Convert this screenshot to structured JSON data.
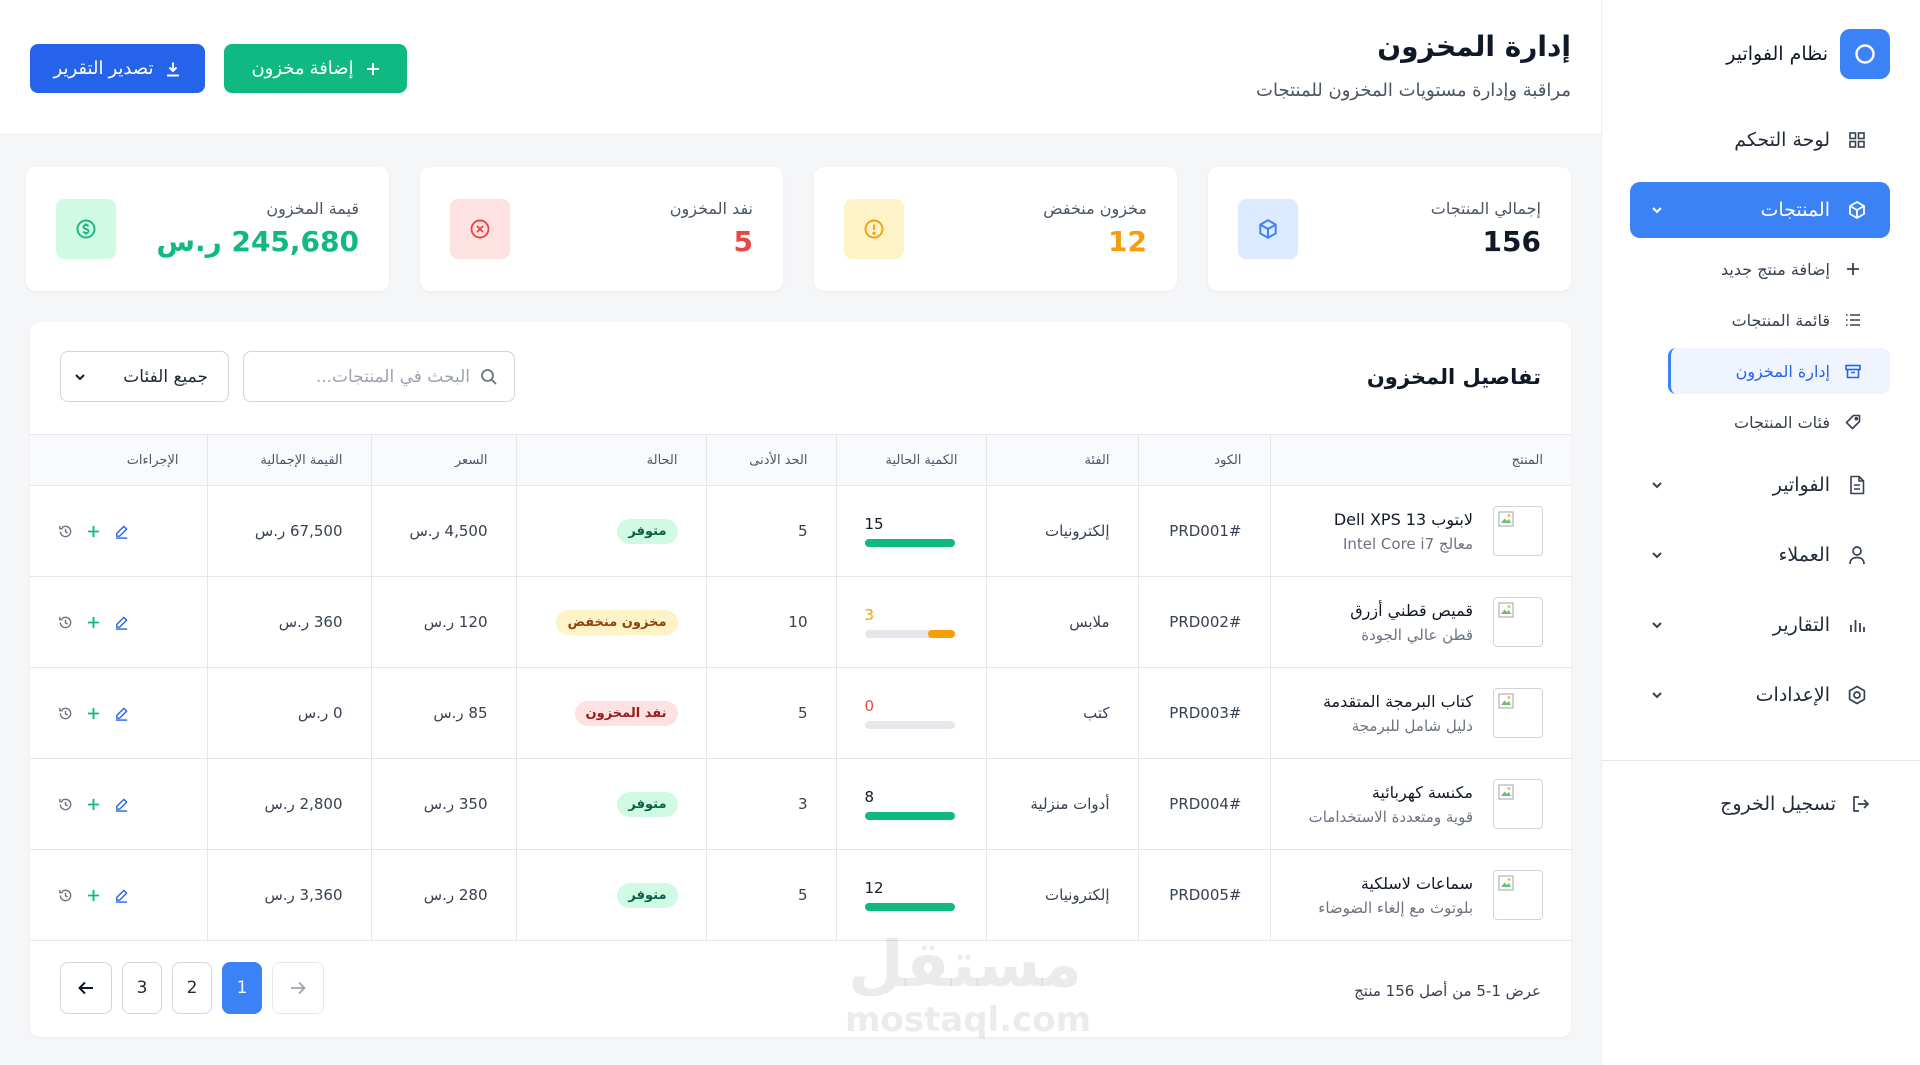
{
  "colors": {
    "primary": "#3b82f6",
    "success": "#10b981",
    "warning": "#f59e0b",
    "danger": "#ef4444"
  },
  "sidebar": {
    "brand": "نظام الفواتير",
    "nav": [
      {
        "label": "لوحة التحكم",
        "icon": "grid-icon"
      },
      {
        "label": "المنتجات",
        "icon": "cube-icon",
        "active": true
      },
      {
        "label": "الفواتير",
        "icon": "document-icon"
      },
      {
        "label": "العملاء",
        "icon": "user-icon"
      },
      {
        "label": "التقارير",
        "icon": "bar-chart-icon"
      },
      {
        "label": "الإعدادات",
        "icon": "settings-icon"
      }
    ],
    "subnav": [
      {
        "label": "إضافة منتج جديد",
        "icon": "plus-icon"
      },
      {
        "label": "قائمة المنتجات",
        "icon": "list-icon"
      },
      {
        "label": "إدارة المخزون",
        "icon": "archive-icon",
        "active": true
      },
      {
        "label": "فئات المنتجات",
        "icon": "tag-icon"
      }
    ],
    "logout": "تسجيل الخروج"
  },
  "header": {
    "title": "إدارة المخزون",
    "subtitle": "مراقبة وإدارة مستويات المخزون للمنتجات",
    "add_button": "إضافة مخزون",
    "export_button": "تصدير التقرير"
  },
  "stats": [
    {
      "label": "إجمالي المنتجات",
      "value": "156",
      "color": "#111827"
    },
    {
      "label": "مخزون منخفض",
      "value": "12",
      "color": "#f59e0b"
    },
    {
      "label": "نفد المخزون",
      "value": "5",
      "color": "#ef4444"
    },
    {
      "label": "قيمة المخزون",
      "value": "245,680 ر.س",
      "color": "#10b981"
    }
  ],
  "details": {
    "title": "تفاصيل المخزون",
    "search_placeholder": "البحث في المنتجات...",
    "category_filter": "جميع الفئات",
    "columns": [
      "المنتج",
      "الكود",
      "الفئة",
      "الكمية الحالية",
      "الحد الأدنى",
      "الحالة",
      "السعر",
      "القيمة الإجمالية",
      "الإجراءات"
    ],
    "rows": [
      {
        "name": "لابتوب Dell XPS 13",
        "desc": "معالج Intel Core i7",
        "code": "PRD001#",
        "category": "إلكترونيات",
        "qty": "15",
        "qty_level": 1.0,
        "qty_color": "#10b981",
        "min": "5",
        "status": "متوفر",
        "status_type": "ok",
        "price": "4,500 ر.س",
        "total": "67,500 ر.س"
      },
      {
        "name": "قميص قطني أزرق",
        "desc": "قطن عالي الجودة",
        "code": "PRD002#",
        "category": "ملابس",
        "qty": "3",
        "qty_level": 0.3,
        "qty_color": "#f59e0b",
        "min": "10",
        "status": "مخزون منخفض",
        "status_type": "low",
        "price": "120 ر.س",
        "total": "360 ر.س"
      },
      {
        "name": "كتاب البرمجة المتقدمة",
        "desc": "دليل شامل للبرمجة",
        "code": "PRD003#",
        "category": "كتب",
        "qty": "0",
        "qty_level": 0.0,
        "qty_color": "#ef4444",
        "min": "5",
        "status": "نفد المخزون",
        "status_type": "out",
        "price": "85 ر.س",
        "total": "0 ر.س"
      },
      {
        "name": "مكنسة كهربائية",
        "desc": "قوية ومتعددة الاستخدامات",
        "code": "PRD004#",
        "category": "أدوات منزلية",
        "qty": "8",
        "qty_level": 1.0,
        "qty_color": "#10b981",
        "min": "3",
        "status": "متوفر",
        "status_type": "ok",
        "price": "350 ر.س",
        "total": "2,800 ر.س"
      },
      {
        "name": "سماعات لاسلكية",
        "desc": "بلوتوث مع إلغاء الضوضاء",
        "code": "PRD005#",
        "category": "إلكترونيات",
        "qty": "12",
        "qty_level": 1.0,
        "qty_color": "#10b981",
        "min": "5",
        "status": "متوفر",
        "status_type": "ok",
        "price": "280 ر.س",
        "total": "3,360 ر.س"
      }
    ],
    "pagination": {
      "info": "عرض 1-5 من أصل 156 منتج",
      "pages": [
        "1",
        "2",
        "3"
      ],
      "current": "1"
    }
  },
  "watermark": {
    "ar": "مستقل",
    "en": "mostaql.com"
  }
}
